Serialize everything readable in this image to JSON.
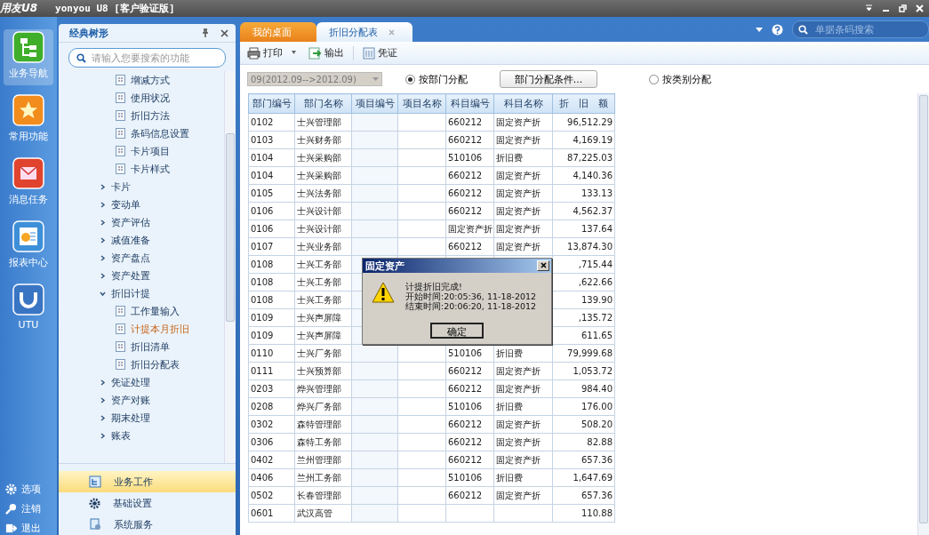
{
  "window": {
    "logo": "用友U8",
    "title": "yonyou U8 [客户验证版]"
  },
  "header": {
    "search": {
      "placeholder": "单据条码搜索"
    }
  },
  "rail": {
    "items": [
      {
        "label": "业务导航",
        "selected": true
      },
      {
        "label": "常用功能",
        "selected": false
      },
      {
        "label": "消息任务",
        "selected": false
      },
      {
        "label": "报表中心",
        "selected": false
      },
      {
        "label": "UTU",
        "selected": false
      }
    ],
    "bottom": [
      {
        "label": "选项"
      },
      {
        "label": "注销"
      },
      {
        "label": "退出"
      }
    ]
  },
  "tree_panel": {
    "title": "经典树形",
    "search": {
      "placeholder": "请输入您要搜索的功能"
    },
    "items": [
      {
        "children": [
          {
            "label": "增减方式",
            "highlighted": false
          },
          {
            "label": "使用状况",
            "highlighted": false
          },
          {
            "label": "折旧方法",
            "highlighted": false
          },
          {
            "label": "条码信息设置",
            "highlighted": false
          },
          {
            "label": "卡片项目",
            "highlighted": false
          },
          {
            "label": "卡片样式",
            "highlighted": false
          }
        ]
      },
      {
        "label": "卡片",
        "expanded": false
      },
      {
        "label": "变动单",
        "expanded": false
      },
      {
        "label": "资产评估",
        "expanded": false
      },
      {
        "label": "减值准备",
        "expanded": false
      },
      {
        "label": "资产盘点",
        "expanded": false
      },
      {
        "label": "资产处置",
        "expanded": false
      },
      {
        "label": "折旧计提",
        "expanded": true,
        "children": [
          {
            "label": "工作量输入",
            "highlighted": false
          },
          {
            "label": "计提本月折旧",
            "highlighted": true
          },
          {
            "label": "折旧清单",
            "highlighted": false
          },
          {
            "label": "折旧分配表",
            "highlighted": false
          }
        ]
      },
      {
        "label": "凭证处理",
        "expanded": false
      },
      {
        "label": "资产对账",
        "expanded": false
      },
      {
        "label": "期末处理",
        "expanded": false
      },
      {
        "label": "账表",
        "expanded": false
      }
    ],
    "sections": [
      {
        "label": "业务工作",
        "selected": true
      },
      {
        "label": "基础设置",
        "selected": false
      },
      {
        "label": "系统服务",
        "selected": false
      }
    ]
  },
  "tabs": [
    {
      "label": "我的桌面",
      "selected": false,
      "closable": false
    },
    {
      "label": "折旧分配表",
      "selected": true,
      "closable": true
    }
  ],
  "toolbar": [
    {
      "label": "打印",
      "menu": true
    },
    {
      "label": "输出",
      "menu": false
    },
    {
      "label": "凭证",
      "menu": false
    }
  ],
  "filter": {
    "period": "09(2012.09-->2012.09)",
    "options": [
      {
        "label": "按部门分配",
        "selected": true
      },
      {
        "label": "按类别分配",
        "selected": false
      }
    ],
    "condition_button": "部门分配条件..."
  },
  "table": {
    "columns": [
      "部门编号",
      "部门名称",
      "项目编号",
      "项目名称",
      "科目编号",
      "科目名称",
      "折　旧　额"
    ],
    "rows": [
      [
        "0102",
        "士兴管理部",
        null,
        null,
        "660212",
        "固定资产折",
        "96,512.29"
      ],
      [
        "0103",
        "士兴财务部",
        null,
        null,
        "660212",
        "固定资产折",
        "4,169.19"
      ],
      [
        "0104",
        "士兴采购部",
        null,
        null,
        "510106",
        "折旧费",
        "87,225.03"
      ],
      [
        "0104",
        "士兴采购部",
        null,
        null,
        "660212",
        "固定资产折",
        "4,140.36"
      ],
      [
        "0105",
        "士兴法务部",
        null,
        null,
        "660212",
        "固定资产折",
        "133.13"
      ],
      [
        "0106",
        "士兴设计部",
        null,
        null,
        "660212",
        "固定资产折",
        "4,562.37"
      ],
      [
        "0106",
        "士兴设计部",
        null,
        null,
        "固定资产折",
        "固定资产折",
        "137.64"
      ],
      [
        "0107",
        "士兴业务部",
        null,
        null,
        "660212",
        "固定资产折",
        "13,874.30"
      ],
      [
        "0108",
        "士兴工务部",
        null,
        null,
        null,
        null,
        ",715.44"
      ],
      [
        "0108",
        "士兴工务部",
        null,
        null,
        null,
        null,
        ",622.66"
      ],
      [
        "0108",
        "士兴工务部",
        null,
        null,
        null,
        null,
        "139.90"
      ],
      [
        "0109",
        "士兴声屏障",
        null,
        null,
        null,
        null,
        ",135.72"
      ],
      [
        "0109",
        "士兴声屏障",
        null,
        null,
        null,
        null,
        "611.65"
      ],
      [
        "0110",
        "士兴厂务部",
        null,
        null,
        "510106",
        "折旧费",
        "79,999.68"
      ],
      [
        "0111",
        "士兴预算部",
        null,
        null,
        "660212",
        "固定资产折",
        "1,053.72"
      ],
      [
        "0203",
        "烨兴管理部",
        null,
        null,
        "660212",
        "固定资产折",
        "984.40"
      ],
      [
        "0208",
        "烨兴厂务部",
        null,
        null,
        "510106",
        "折旧费",
        "176.00"
      ],
      [
        "0302",
        "森特管理部",
        null,
        null,
        "660212",
        "固定资产折",
        "508.20"
      ],
      [
        "0306",
        "森特工务部",
        null,
        null,
        "660212",
        "固定资产折",
        "82.88"
      ],
      [
        "0402",
        "兰州管理部",
        null,
        null,
        "660212",
        "固定资产折",
        "657.36"
      ],
      [
        "0406",
        "兰州工务部",
        null,
        null,
        "510106",
        "折旧费",
        "1,647.69"
      ],
      [
        "0502",
        "长春管理部",
        null,
        null,
        "660212",
        "固定资产折",
        "657.36"
      ],
      [
        "0601",
        "武汉高管",
        null,
        null,
        null,
        null,
        "110.88"
      ]
    ]
  },
  "dialog": {
    "title": "固定资产",
    "lines": [
      "计提折旧完成!",
      "开始时间:20:05:36, 11-18-2012",
      "结束时间:20:06:20, 11-18-2012"
    ],
    "button": "确定"
  }
}
